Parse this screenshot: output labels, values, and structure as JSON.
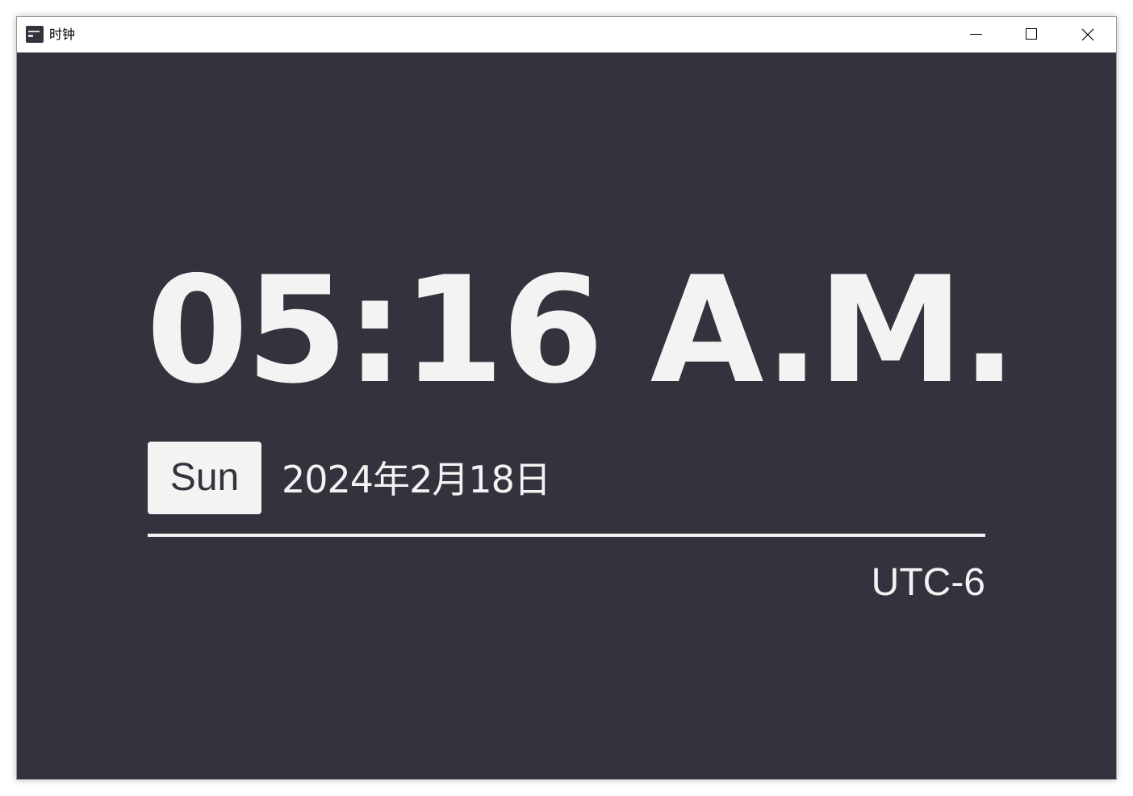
{
  "window": {
    "title": "时钟",
    "controls": {
      "minimize_icon": "minimize-icon",
      "maximize_icon": "maximize-icon",
      "close_icon": "close-icon"
    }
  },
  "clock": {
    "time": "05:16 A.M.",
    "weekday": "Sun",
    "date": "2024年2月18日",
    "timezone": "UTC-6"
  },
  "colors": {
    "background": "#34323c",
    "foreground": "#f3f3f3",
    "titlebar": "#ffffff"
  }
}
